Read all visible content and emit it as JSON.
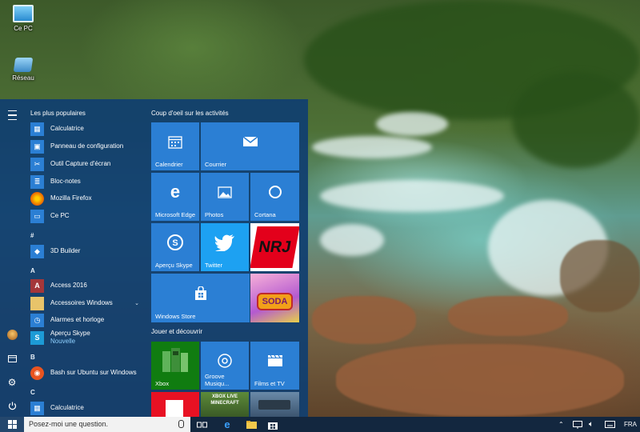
{
  "desktop": {
    "icons": [
      {
        "label": "Ce PC",
        "icon": "computer-icon"
      },
      {
        "label": "Réseau",
        "icon": "network-icon"
      }
    ]
  },
  "start_menu": {
    "rail": [
      "hamburger-menu-icon",
      "user-avatar",
      "file-explorer-icon",
      "settings-gear-icon",
      "power-icon"
    ],
    "most_used_header": "Les plus populaires",
    "most_used": [
      {
        "label": "Calculatrice",
        "icon": "calculator-icon",
        "color": "#2b7fd4"
      },
      {
        "label": "Panneau de configuration",
        "icon": "control-panel-icon",
        "color": "#2b7fd4"
      },
      {
        "label": "Outil Capture d'écran",
        "icon": "snipping-tool-icon",
        "color": "#2b7fd4"
      },
      {
        "label": "Bloc-notes",
        "icon": "notepad-icon",
        "color": "#2b7fd4"
      },
      {
        "label": "Mozilla Firefox",
        "icon": "firefox-icon",
        "color": "#e66000"
      },
      {
        "label": "Ce PC",
        "icon": "computer-icon",
        "color": "#2b7fd4"
      }
    ],
    "sections": [
      {
        "letter": "#",
        "items": [
          {
            "label": "3D Builder",
            "icon": "3d-builder-icon",
            "color": "#2b7fd4"
          }
        ]
      },
      {
        "letter": "A",
        "items": [
          {
            "label": "Access 2016",
            "icon": "access-icon",
            "color": "#a4373a"
          },
          {
            "label": "Accessoires Windows",
            "icon": "folder-icon",
            "color": "#e8c46a"
          },
          {
            "label": "Alarmes et horloge",
            "icon": "alarm-clock-icon",
            "color": "#2b7fd4"
          },
          {
            "label": "Aperçu Skype",
            "sub": "Nouvelle",
            "icon": "skype-icon",
            "color": "#1d9bd6"
          }
        ]
      },
      {
        "letter": "B",
        "items": [
          {
            "label": "Bash sur Ubuntu sur Windows",
            "icon": "ubuntu-icon",
            "color": "#e95420"
          }
        ]
      },
      {
        "letter": "C",
        "items": [
          {
            "label": "Calculatrice",
            "icon": "calculator-icon",
            "color": "#2b7fd4"
          }
        ]
      }
    ],
    "tile_groups": [
      {
        "title": "Coup d'oeil sur les activités"
      },
      {
        "title": "Jouer et découvrir"
      }
    ],
    "tiles": {
      "calendar": "Calendrier",
      "mail": "Courrier",
      "edge": "Microsoft Edge",
      "photos": "Photos",
      "cortana": "Cortana",
      "nrj_logo": "NRJ",
      "skype": "Aperçu Skype",
      "twitter": "Twitter",
      "store": "Windows Store",
      "soda_logo": "SODA",
      "xbox": "Xbox",
      "groove": "Groove Musiqu...",
      "films": "Films et TV",
      "minecraft_logo": "XBOX LIVE MINECRAFT"
    }
  },
  "taskbar": {
    "search_placeholder": "Posez-moi une question.",
    "language": "FRA"
  },
  "colors": {
    "accent": "#2b7fd4",
    "start_bg": "#103e70",
    "taskbar_bg": "#13273f"
  }
}
